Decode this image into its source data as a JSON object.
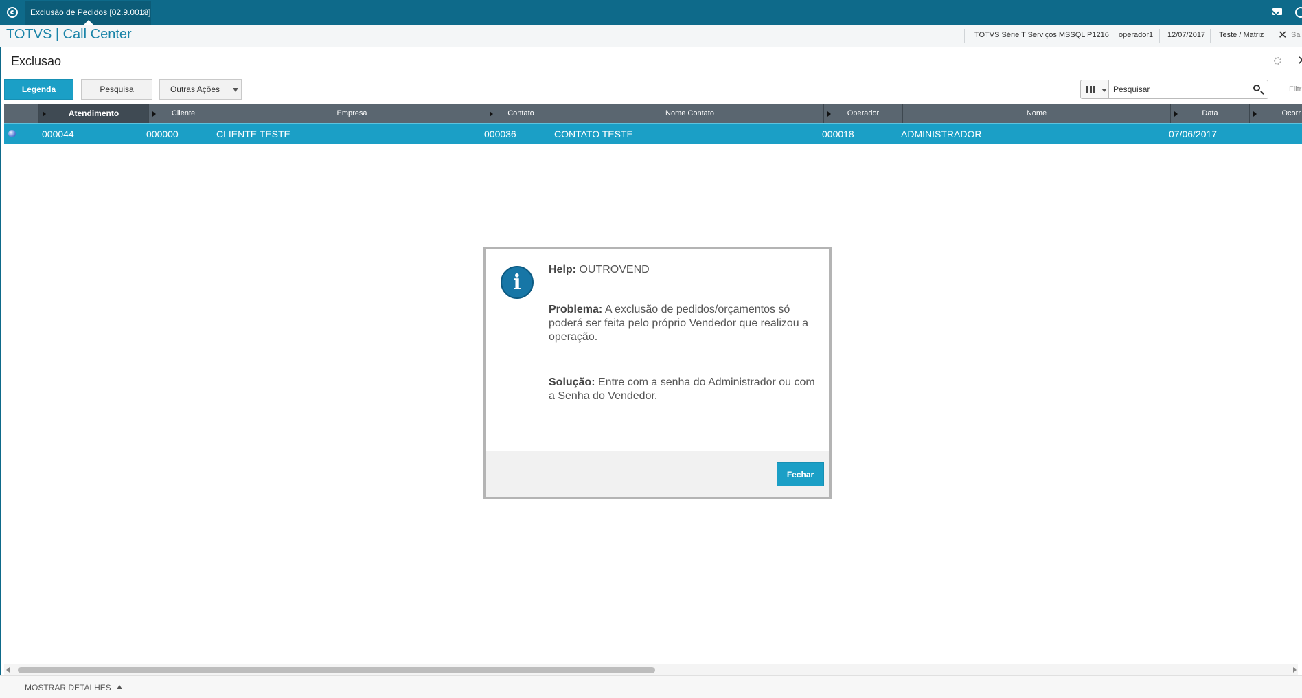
{
  "window": {
    "tab_title": "Exclusão de Pedidos [02.9.0013]",
    "tab_close": "×"
  },
  "header": {
    "brand": "TOTVS | Call Center",
    "environment": "TOTVS Série T Serviços MSSQL P1216",
    "user": "operador1",
    "date": "12/07/2017",
    "branch": "Teste / Matriz",
    "exit_symbol": "✕",
    "exit_label": "Sa"
  },
  "page": {
    "title": "Exclusao"
  },
  "toolbar": {
    "legenda_label": "Legenda",
    "pesquisa_label": "Pesquisa",
    "outras_label": "Outras Ações"
  },
  "search": {
    "value": "Pesquisar",
    "filter_label": "Filtr"
  },
  "grid": {
    "columns": [
      "Atendimento",
      "Cliente",
      "Empresa",
      "Contato",
      "Nome Contato",
      "Operador",
      "Nome",
      "Data",
      "Ocorr"
    ],
    "rows": [
      {
        "atendimento": "000044",
        "cliente": "000000",
        "empresa": "CLIENTE TESTE",
        "contato": "000036",
        "nome_contato": "CONTATO TESTE",
        "operador": "000018",
        "nome": "ADMINISTRADOR",
        "data": "07/06/2017"
      }
    ]
  },
  "dialog": {
    "help_label": "Help:",
    "help_value": "OUTROVEND",
    "problema_label": "Problema:",
    "problema_text": "A exclusão de pedidos/orçamentos só poderá ser feita pelo próprio Vendedor que realizou a operação.",
    "solucao_label": "Solução:",
    "solucao_text": "Entre com a senha do Administrador ou com a Senha do Vendedor.",
    "close_label": "Fechar",
    "icon_glyph": "i"
  },
  "footer": {
    "details_label": "MOSTRAR DETALHES"
  },
  "colors": {
    "titlebar": "#0e6a8a",
    "accent": "#1b9fc6",
    "grid_header": "#5a6670"
  }
}
